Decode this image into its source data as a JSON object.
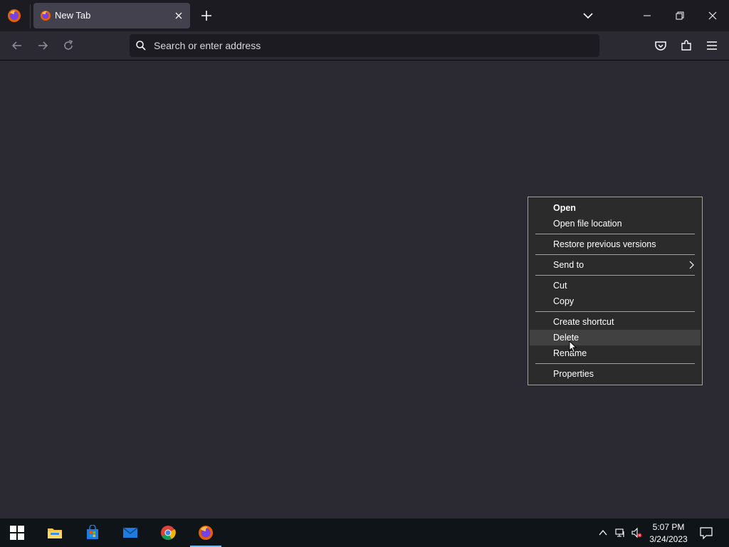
{
  "browser": {
    "tab": {
      "title": "New Tab",
      "active": true
    },
    "urlbar": {
      "placeholder": "Search or enter address",
      "value": ""
    }
  },
  "icons": {
    "tabbar_app": "firefox-icon",
    "tab_favicon": "firefox-icon",
    "tab_close": "close-icon",
    "new_tab": "plus-icon",
    "tab_list": "chevron-down-icon",
    "window": [
      "minimize-icon",
      "restore-icon",
      "close-icon"
    ],
    "nav": [
      "back-arrow-icon",
      "forward-arrow-icon",
      "reload-icon"
    ],
    "toolbar": [
      "pocket-icon",
      "extensions-icon",
      "hamburger-menu-icon"
    ]
  },
  "context_menu": {
    "groups": [
      [
        {
          "label": "Open",
          "bold": true
        },
        {
          "label": "Open file location"
        }
      ],
      [
        {
          "label": "Restore previous versions"
        }
      ],
      [
        {
          "label": "Send to",
          "submenu": true
        }
      ],
      [
        {
          "label": "Cut"
        },
        {
          "label": "Copy"
        }
      ],
      [
        {
          "label": "Create shortcut"
        },
        {
          "label": "Delete",
          "highlighted": true
        },
        {
          "label": "Rename"
        }
      ],
      [
        {
          "label": "Properties"
        }
      ]
    ]
  },
  "taskbar": {
    "apps": [
      "windows-start-icon",
      "file-explorer-icon",
      "microsoft-store-icon",
      "mail-icon",
      "chrome-icon",
      "firefox-icon"
    ],
    "active_app": "firefox-icon",
    "tray_icons": [
      "chevron-up-icon",
      "network-icon",
      "volume-muted-icon"
    ],
    "clock": {
      "time": "5:07 PM",
      "date": "3/24/2023"
    }
  },
  "colors": {
    "tabstrip_bg": "#1c1b22",
    "content_bg": "#2b2a33",
    "menu_bg": "#2b2b2b",
    "menu_highlight": "#414141",
    "taskbar_bg": "#0f1419",
    "accent": "#76b9ed"
  }
}
